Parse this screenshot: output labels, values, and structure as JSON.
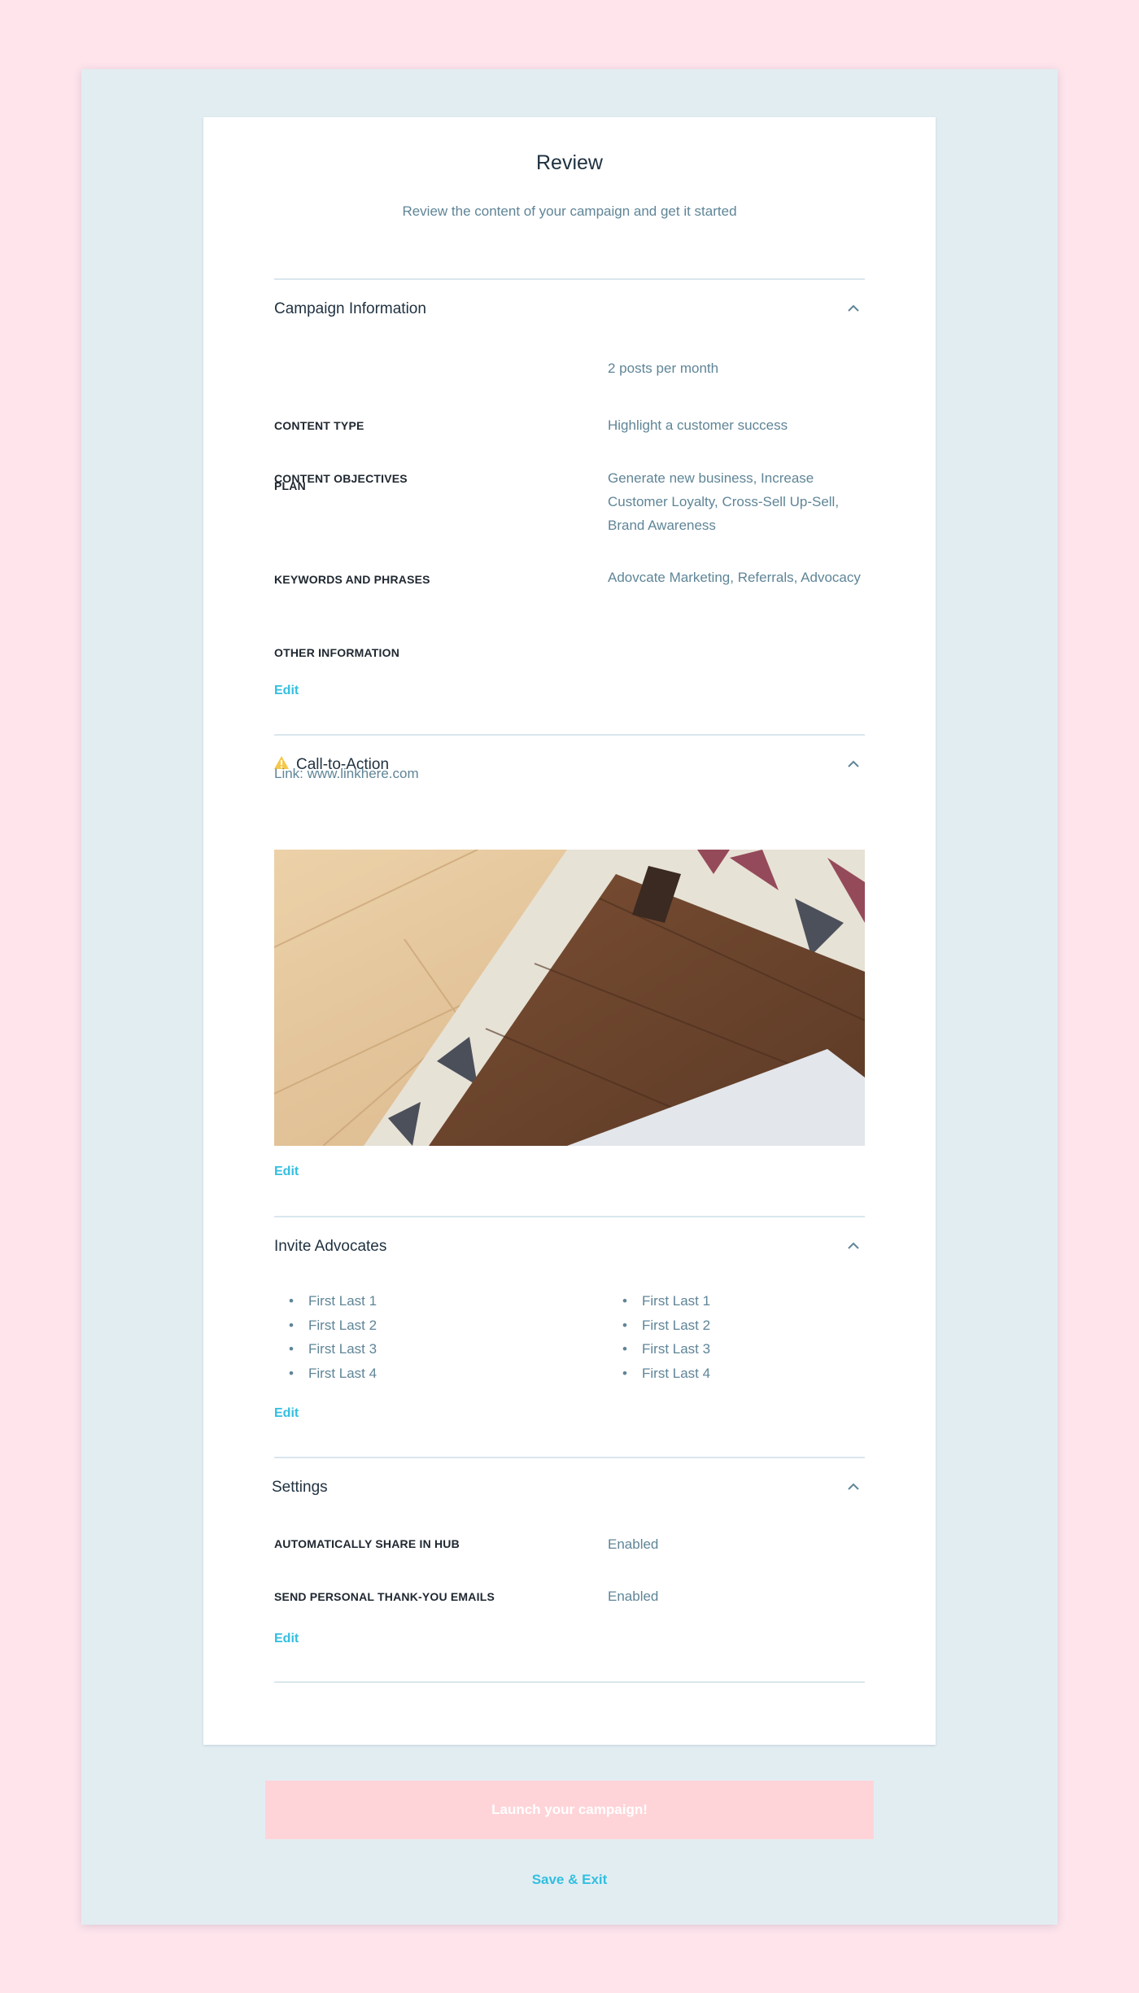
{
  "page": {
    "title": "Review",
    "subtitle": "Review the content of your campaign and get it started"
  },
  "campaign_info": {
    "title": "Campaign Information",
    "rows": [
      {
        "label": "PLAN",
        "value": "2 posts per month"
      },
      {
        "label": "CONTENT TYPE",
        "value": "Highlight a customer success"
      },
      {
        "label": "CONTENT OBJECTIVES",
        "value": "Generate new business, Increase Customer Loyalty, Cross-Sell Up-Sell, Brand Awareness"
      },
      {
        "label": "KEYWORDS AND PHRASES",
        "value": "Adovcate Marketing, Referrals, Advocacy"
      },
      {
        "label": "OTHER INFORMATION",
        "value": ""
      }
    ],
    "edit_label": "Edit"
  },
  "call_to_action": {
    "title": "Call-to-Action",
    "warning_icon": "warning-icon",
    "link_text": "Link: www.linkhere.com",
    "image_icon": "photo-wood-floor-rug-laptop",
    "edit_label": "Edit"
  },
  "invite_advocates": {
    "title": "Invite Advocates",
    "column_left": [
      "First Last 1",
      "First Last 2",
      "First Last 3",
      "First Last 4"
    ],
    "column_right": [
      "First Last 1",
      "First Last 2",
      "First Last 3",
      "First Last 4"
    ],
    "edit_label": "Edit"
  },
  "settings": {
    "title": "Settings",
    "rows": [
      {
        "label": "AUTOMATICALLY SHARE IN HUB",
        "value": "Enabled"
      },
      {
        "label": "SEND PERSONAL THANK-YOU EMAILS",
        "value": "Enabled"
      }
    ],
    "edit_label": "Edit"
  },
  "footer": {
    "launch_label": "Launch your campaign!",
    "save_exit_label": "Save & Exit"
  },
  "colors": {
    "page_background": "#ffe4ec",
    "frame_background": "#e2edf2",
    "accent": "#33bfe0",
    "launch_button": "#ffd4d8",
    "muted_text": "#5f8597",
    "warning": "#f5c84c"
  }
}
